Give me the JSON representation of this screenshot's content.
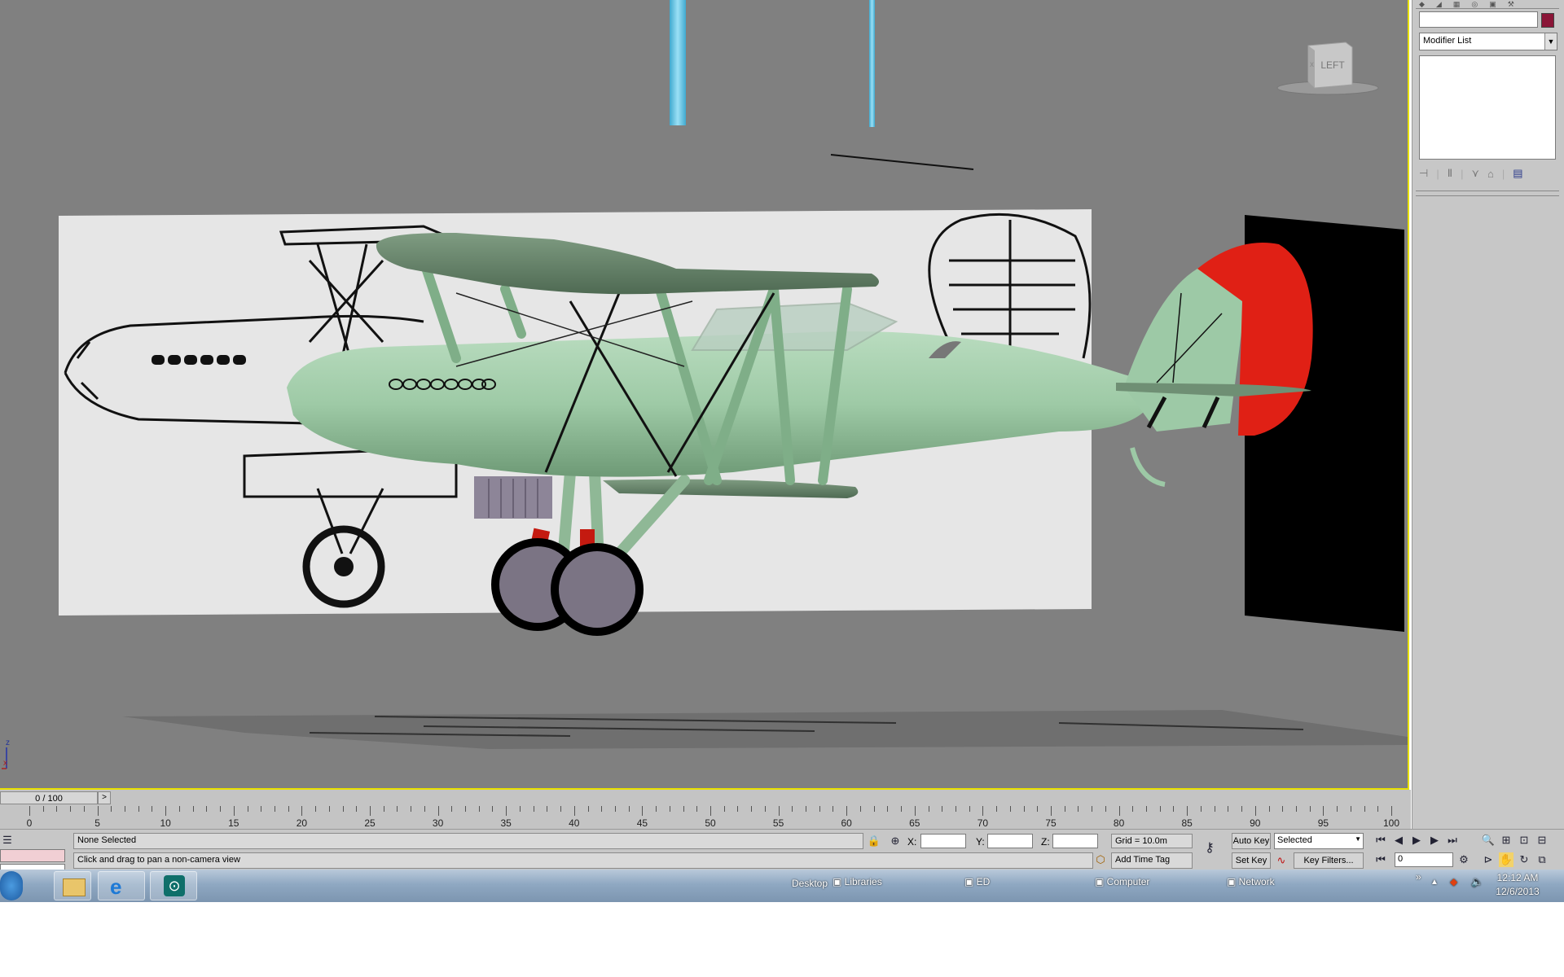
{
  "viewport": {
    "viewcube_label": "LEFT",
    "axis_labels": {
      "z": "z",
      "x": "x"
    }
  },
  "command_panel": {
    "modifier_list": "Modifier List",
    "modifier_arrow": "▼"
  },
  "timeline": {
    "frame_counter": "0 / 100",
    "next_arrow": ">",
    "tick_labels": [
      "0",
      "5",
      "10",
      "15",
      "20",
      "25",
      "30",
      "35",
      "40",
      "45",
      "50",
      "55",
      "60",
      "65",
      "70",
      "75",
      "80",
      "85",
      "90",
      "95",
      "100"
    ]
  },
  "status": {
    "selection": "None Selected",
    "prompt": "Click and drag to pan a non-camera view",
    "x_label": "X:",
    "y_label": "Y:",
    "z_label": "Z:",
    "grid": "Grid = 10.0m",
    "add_time_tag": "Add Time Tag",
    "auto_key": "Auto Key",
    "set_key": "Set Key",
    "selected_dropdown": "Selected",
    "key_filters": "Key Filters...",
    "current_frame": "0"
  },
  "taskbar": {
    "desktop": "Desktop",
    "libraries": "Libraries",
    "ed": "ED",
    "computer": "Computer",
    "network": "Network",
    "overflow": "»",
    "time": "12:12 AM",
    "date": "12/6/2013"
  },
  "colors": {
    "viewport_bg": "#808080",
    "viewport_border": "#e8e000",
    "fuselage": "#9dc9a6",
    "upper_wing": "#627f66",
    "rudder": "#e02015"
  }
}
